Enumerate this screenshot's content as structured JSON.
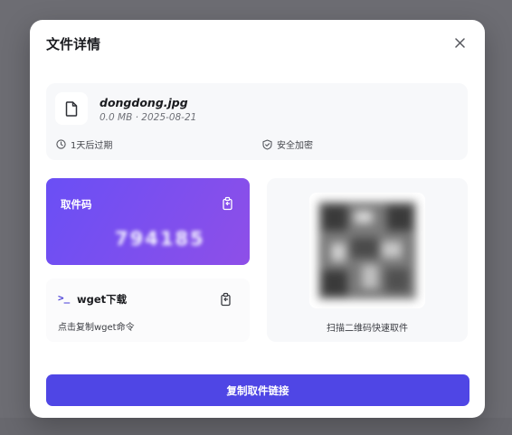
{
  "modal": {
    "title": "文件详情"
  },
  "file": {
    "name": "dongdong.jpg",
    "meta": "0.0 MB · 2025-08-21",
    "expiry": "1天后过期",
    "security": "安全加密"
  },
  "pickup_code": {
    "label": "取件码",
    "value": "794185"
  },
  "wget": {
    "prompt": ">_",
    "title": "wget下载",
    "hint": "点击复制wget命令"
  },
  "qr": {
    "caption": "扫描二维码快速取件"
  },
  "actions": {
    "copy_link_label": "复制取件链接"
  },
  "colors": {
    "accent": "#4f46e5",
    "code_gradient_start": "#6a4ff5",
    "code_gradient_end": "#8e4fe8"
  },
  "icons": {
    "close": "close-icon",
    "file": "file-icon",
    "clock": "clock-icon",
    "shield": "shield-icon",
    "copy": "copy-icon"
  }
}
